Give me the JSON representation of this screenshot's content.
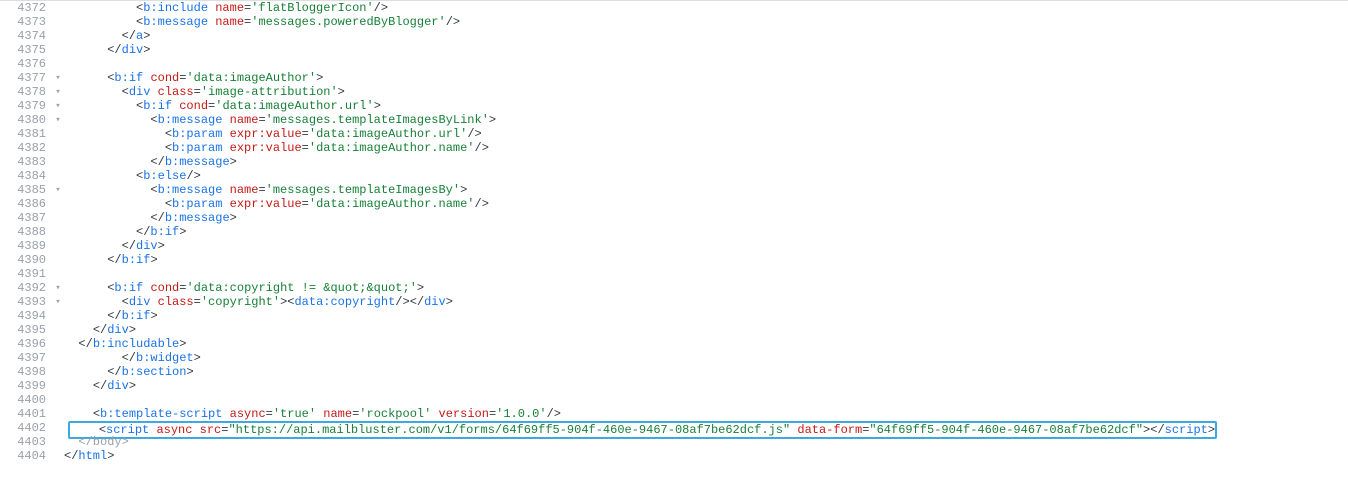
{
  "editor": {
    "highlight_color": "#3da9e0",
    "gutter_color": "#9aa0a6",
    "lines": [
      {
        "n": 4372,
        "indent": 10,
        "tokens": [
          {
            "c": "p",
            "t": "<"
          },
          {
            "c": "t",
            "t": "b:include"
          },
          {
            "c": "p",
            "t": " "
          },
          {
            "c": "a",
            "t": "name"
          },
          {
            "c": "p",
            "t": "="
          },
          {
            "c": "s",
            "t": "'flatBloggerIcon'"
          },
          {
            "c": "p",
            "t": "/>"
          }
        ]
      },
      {
        "n": 4373,
        "indent": 10,
        "tokens": [
          {
            "c": "p",
            "t": "<"
          },
          {
            "c": "t",
            "t": "b:message"
          },
          {
            "c": "p",
            "t": " "
          },
          {
            "c": "a",
            "t": "name"
          },
          {
            "c": "p",
            "t": "="
          },
          {
            "c": "s",
            "t": "'messages.poweredByBlogger'"
          },
          {
            "c": "p",
            "t": "/>"
          }
        ]
      },
      {
        "n": 4374,
        "indent": 8,
        "tokens": [
          {
            "c": "p",
            "t": "</"
          },
          {
            "c": "t",
            "t": "a"
          },
          {
            "c": "p",
            "t": ">"
          }
        ]
      },
      {
        "n": 4375,
        "indent": 6,
        "tokens": [
          {
            "c": "p",
            "t": "</"
          },
          {
            "c": "t",
            "t": "div"
          },
          {
            "c": "p",
            "t": ">"
          }
        ]
      },
      {
        "n": 4376,
        "indent": 0,
        "tokens": []
      },
      {
        "n": 4377,
        "fold": "▾",
        "indent": 6,
        "tokens": [
          {
            "c": "p",
            "t": "<"
          },
          {
            "c": "t",
            "t": "b:if"
          },
          {
            "c": "p",
            "t": " "
          },
          {
            "c": "a",
            "t": "cond"
          },
          {
            "c": "p",
            "t": "="
          },
          {
            "c": "s",
            "t": "'data:imageAuthor'"
          },
          {
            "c": "p",
            "t": ">"
          }
        ]
      },
      {
        "n": 4378,
        "fold": "▾",
        "indent": 8,
        "tokens": [
          {
            "c": "p",
            "t": "<"
          },
          {
            "c": "t",
            "t": "div"
          },
          {
            "c": "p",
            "t": " "
          },
          {
            "c": "a",
            "t": "class"
          },
          {
            "c": "p",
            "t": "="
          },
          {
            "c": "s",
            "t": "'image-attribution'"
          },
          {
            "c": "p",
            "t": ">"
          }
        ]
      },
      {
        "n": 4379,
        "fold": "▾",
        "indent": 10,
        "tokens": [
          {
            "c": "p",
            "t": "<"
          },
          {
            "c": "t",
            "t": "b:if"
          },
          {
            "c": "p",
            "t": " "
          },
          {
            "c": "a",
            "t": "cond"
          },
          {
            "c": "p",
            "t": "="
          },
          {
            "c": "s",
            "t": "'data:imageAuthor.url'"
          },
          {
            "c": "p",
            "t": ">"
          }
        ]
      },
      {
        "n": 4380,
        "fold": "▾",
        "indent": 12,
        "tokens": [
          {
            "c": "p",
            "t": "<"
          },
          {
            "c": "t",
            "t": "b:message"
          },
          {
            "c": "p",
            "t": " "
          },
          {
            "c": "a",
            "t": "name"
          },
          {
            "c": "p",
            "t": "="
          },
          {
            "c": "s",
            "t": "'messages.templateImagesByLink'"
          },
          {
            "c": "p",
            "t": ">"
          }
        ]
      },
      {
        "n": 4381,
        "indent": 14,
        "tokens": [
          {
            "c": "p",
            "t": "<"
          },
          {
            "c": "t",
            "t": "b:param"
          },
          {
            "c": "p",
            "t": " "
          },
          {
            "c": "a",
            "t": "expr:value"
          },
          {
            "c": "p",
            "t": "="
          },
          {
            "c": "s",
            "t": "'data:imageAuthor.url'"
          },
          {
            "c": "p",
            "t": "/>"
          }
        ]
      },
      {
        "n": 4382,
        "indent": 14,
        "tokens": [
          {
            "c": "p",
            "t": "<"
          },
          {
            "c": "t",
            "t": "b:param"
          },
          {
            "c": "p",
            "t": " "
          },
          {
            "c": "a",
            "t": "expr:value"
          },
          {
            "c": "p",
            "t": "="
          },
          {
            "c": "s",
            "t": "'data:imageAuthor.name'"
          },
          {
            "c": "p",
            "t": "/>"
          }
        ]
      },
      {
        "n": 4383,
        "indent": 12,
        "tokens": [
          {
            "c": "p",
            "t": "</"
          },
          {
            "c": "t",
            "t": "b:message"
          },
          {
            "c": "p",
            "t": ">"
          }
        ]
      },
      {
        "n": 4384,
        "indent": 10,
        "tokens": [
          {
            "c": "p",
            "t": "<"
          },
          {
            "c": "t",
            "t": "b:else"
          },
          {
            "c": "p",
            "t": "/>"
          }
        ]
      },
      {
        "n": 4385,
        "fold": "▾",
        "indent": 12,
        "tokens": [
          {
            "c": "p",
            "t": "<"
          },
          {
            "c": "t",
            "t": "b:message"
          },
          {
            "c": "p",
            "t": " "
          },
          {
            "c": "a",
            "t": "name"
          },
          {
            "c": "p",
            "t": "="
          },
          {
            "c": "s",
            "t": "'messages.templateImagesBy'"
          },
          {
            "c": "p",
            "t": ">"
          }
        ]
      },
      {
        "n": 4386,
        "indent": 14,
        "tokens": [
          {
            "c": "p",
            "t": "<"
          },
          {
            "c": "t",
            "t": "b:param"
          },
          {
            "c": "p",
            "t": " "
          },
          {
            "c": "a",
            "t": "expr:value"
          },
          {
            "c": "p",
            "t": "="
          },
          {
            "c": "s",
            "t": "'data:imageAuthor.name'"
          },
          {
            "c": "p",
            "t": "/>"
          }
        ]
      },
      {
        "n": 4387,
        "indent": 12,
        "tokens": [
          {
            "c": "p",
            "t": "</"
          },
          {
            "c": "t",
            "t": "b:message"
          },
          {
            "c": "p",
            "t": ">"
          }
        ]
      },
      {
        "n": 4388,
        "indent": 10,
        "tokens": [
          {
            "c": "p",
            "t": "</"
          },
          {
            "c": "t",
            "t": "b:if"
          },
          {
            "c": "p",
            "t": ">"
          }
        ]
      },
      {
        "n": 4389,
        "indent": 8,
        "tokens": [
          {
            "c": "p",
            "t": "</"
          },
          {
            "c": "t",
            "t": "div"
          },
          {
            "c": "p",
            "t": ">"
          }
        ]
      },
      {
        "n": 4390,
        "indent": 6,
        "tokens": [
          {
            "c": "p",
            "t": "</"
          },
          {
            "c": "t",
            "t": "b:if"
          },
          {
            "c": "p",
            "t": ">"
          }
        ]
      },
      {
        "n": 4391,
        "indent": 0,
        "tokens": []
      },
      {
        "n": 4392,
        "fold": "▾",
        "indent": 6,
        "tokens": [
          {
            "c": "p",
            "t": "<"
          },
          {
            "c": "t",
            "t": "b:if"
          },
          {
            "c": "p",
            "t": " "
          },
          {
            "c": "a",
            "t": "cond"
          },
          {
            "c": "p",
            "t": "="
          },
          {
            "c": "s",
            "t": "'data:copyright != &quot;&quot;'"
          },
          {
            "c": "p",
            "t": ">"
          }
        ]
      },
      {
        "n": 4393,
        "fold": "▾",
        "indent": 8,
        "tokens": [
          {
            "c": "p",
            "t": "<"
          },
          {
            "c": "t",
            "t": "div"
          },
          {
            "c": "p",
            "t": " "
          },
          {
            "c": "a",
            "t": "class"
          },
          {
            "c": "p",
            "t": "="
          },
          {
            "c": "s",
            "t": "'copyright'"
          },
          {
            "c": "p",
            "t": "><"
          },
          {
            "c": "t",
            "t": "data:copyright"
          },
          {
            "c": "p",
            "t": "/></"
          },
          {
            "c": "t",
            "t": "div"
          },
          {
            "c": "p",
            "t": ">"
          }
        ]
      },
      {
        "n": 4394,
        "indent": 6,
        "tokens": [
          {
            "c": "p",
            "t": "</"
          },
          {
            "c": "t",
            "t": "b:if"
          },
          {
            "c": "p",
            "t": ">"
          }
        ]
      },
      {
        "n": 4395,
        "indent": 4,
        "tokens": [
          {
            "c": "p",
            "t": "</"
          },
          {
            "c": "t",
            "t": "div"
          },
          {
            "c": "p",
            "t": ">"
          }
        ]
      },
      {
        "n": 4396,
        "indent": 2,
        "tokens": [
          {
            "c": "p",
            "t": "</"
          },
          {
            "c": "t",
            "t": "b:includable"
          },
          {
            "c": "p",
            "t": ">"
          }
        ]
      },
      {
        "n": 4397,
        "indent": 8,
        "tokens": [
          {
            "c": "p",
            "t": "</"
          },
          {
            "c": "t",
            "t": "b:widget"
          },
          {
            "c": "p",
            "t": ">"
          }
        ]
      },
      {
        "n": 4398,
        "indent": 6,
        "tokens": [
          {
            "c": "p",
            "t": "</"
          },
          {
            "c": "t",
            "t": "b:section"
          },
          {
            "c": "p",
            "t": ">"
          }
        ]
      },
      {
        "n": 4399,
        "indent": 4,
        "tokens": [
          {
            "c": "p",
            "t": "</"
          },
          {
            "c": "t",
            "t": "div"
          },
          {
            "c": "p",
            "t": ">"
          }
        ]
      },
      {
        "n": 4400,
        "indent": 0,
        "tokens": []
      },
      {
        "n": 4401,
        "indent": 4,
        "tokens": [
          {
            "c": "p",
            "t": "<"
          },
          {
            "c": "t",
            "t": "b:template-script"
          },
          {
            "c": "p",
            "t": " "
          },
          {
            "c": "a",
            "t": "async"
          },
          {
            "c": "p",
            "t": "="
          },
          {
            "c": "s",
            "t": "'true'"
          },
          {
            "c": "p",
            "t": " "
          },
          {
            "c": "a",
            "t": "name"
          },
          {
            "c": "p",
            "t": "="
          },
          {
            "c": "s",
            "t": "'rockpool'"
          },
          {
            "c": "p",
            "t": " "
          },
          {
            "c": "a",
            "t": "version"
          },
          {
            "c": "p",
            "t": "="
          },
          {
            "c": "s",
            "t": "'1.0.0'"
          },
          {
            "c": "p",
            "t": "/>"
          }
        ]
      },
      {
        "n": 4402,
        "highlight": true,
        "indent": 4,
        "tokens": [
          {
            "c": "p",
            "t": "<"
          },
          {
            "c": "t",
            "t": "script"
          },
          {
            "c": "p",
            "t": " "
          },
          {
            "c": "a",
            "t": "async"
          },
          {
            "c": "p",
            "t": " "
          },
          {
            "c": "a",
            "t": "src"
          },
          {
            "c": "p",
            "t": "="
          },
          {
            "c": "s",
            "t": "\"https://api.mailbluster.com/v1/forms/64f69ff5-904f-460e-9467-08af7be62dcf.js\""
          },
          {
            "c": "p",
            "t": " "
          },
          {
            "c": "a",
            "t": "data-form"
          },
          {
            "c": "p",
            "t": "="
          },
          {
            "c": "s",
            "t": "\"64f69ff5-904f-460e-9467-08af7be62dcf\""
          },
          {
            "c": "p",
            "t": "></"
          },
          {
            "c": "t",
            "t": "script"
          },
          {
            "c": "p",
            "t": ">"
          }
        ]
      },
      {
        "n": 4403,
        "indent": 2,
        "tokens": [
          {
            "c": "d",
            "t": "</body>"
          }
        ]
      },
      {
        "n": 4404,
        "indent": 0,
        "tokens": [
          {
            "c": "p",
            "t": "</"
          },
          {
            "c": "t",
            "t": "html"
          },
          {
            "c": "p",
            "t": ">"
          }
        ]
      }
    ]
  }
}
